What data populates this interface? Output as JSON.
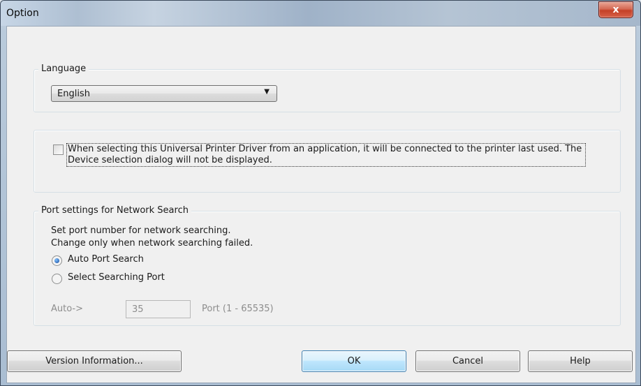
{
  "window": {
    "title": "Option",
    "close_glyph": "x"
  },
  "language_group": {
    "label": "Language",
    "selected": "English"
  },
  "connection_group": {
    "checkbox_checked": false,
    "label": "When selecting this Universal Printer Driver from an application, it will be connected to the printer last used. The Device selection dialog will not be displayed."
  },
  "port_group": {
    "label": "Port settings for Network Search",
    "description_line1": "Set port number for network searching.",
    "description_line2": "Change only when network searching failed.",
    "radio_auto": {
      "label": "Auto Port Search",
      "selected": true
    },
    "radio_select": {
      "label": "Select Searching Port",
      "selected": false
    },
    "auto_label": "Auto->",
    "port_value": "35",
    "port_range": "Port (1 - 65535)"
  },
  "buttons": {
    "version": "Version Information...",
    "ok": "OK",
    "cancel": "Cancel",
    "help": "Help"
  },
  "colors": {
    "accent_blue": "#3c7fb1",
    "close_red": "#c44027"
  }
}
